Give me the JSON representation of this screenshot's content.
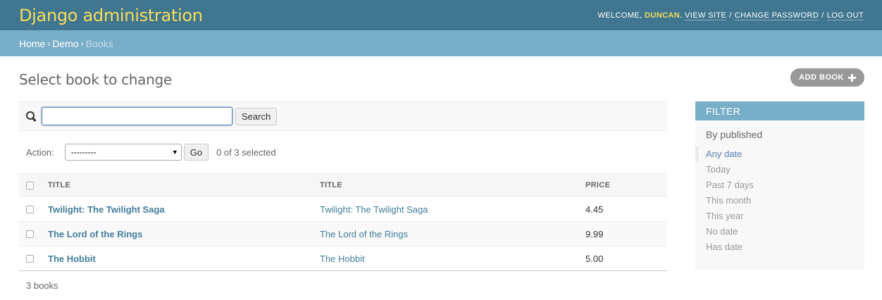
{
  "header": {
    "site_name": "Django administration",
    "welcome": "WELCOME,",
    "user": "DUNCAN",
    "view_site": "VIEW SITE",
    "change_password": "CHANGE PASSWORD",
    "log_out": "LOG OUT"
  },
  "breadcrumbs": {
    "home": "Home",
    "app": "Demo",
    "current": "Books"
  },
  "page": {
    "title": "Select book to change",
    "add_label": "ADD BOOK"
  },
  "search": {
    "value": "",
    "button": "Search"
  },
  "actions": {
    "label": "Action:",
    "selected_option": "---------",
    "go": "Go",
    "counter": "0 of 3 selected"
  },
  "table": {
    "headers": [
      "TITLE",
      "TITLE",
      "PRICE"
    ],
    "rows": [
      {
        "title_link": "Twilight: The Twilight Saga",
        "title": "Twilight: The Twilight Saga",
        "price": "4.45"
      },
      {
        "title_link": "The Lord of the Rings",
        "title": "The Lord of the Rings",
        "price": "9.99"
      },
      {
        "title_link": "The Hobbit",
        "title": "The Hobbit",
        "price": "5.00"
      }
    ]
  },
  "paginator": "3 books",
  "filter": {
    "heading": "FILTER",
    "group": "By published",
    "options": [
      "Any date",
      "Today",
      "Past 7 days",
      "This month",
      "This year",
      "No date",
      "Has date"
    ],
    "selected": "Any date"
  },
  "colors": {
    "header_bg": "#417690",
    "breadcrumb_bg": "#79aec8",
    "site_name": "#f5dd5d",
    "link": "#447e9b"
  }
}
